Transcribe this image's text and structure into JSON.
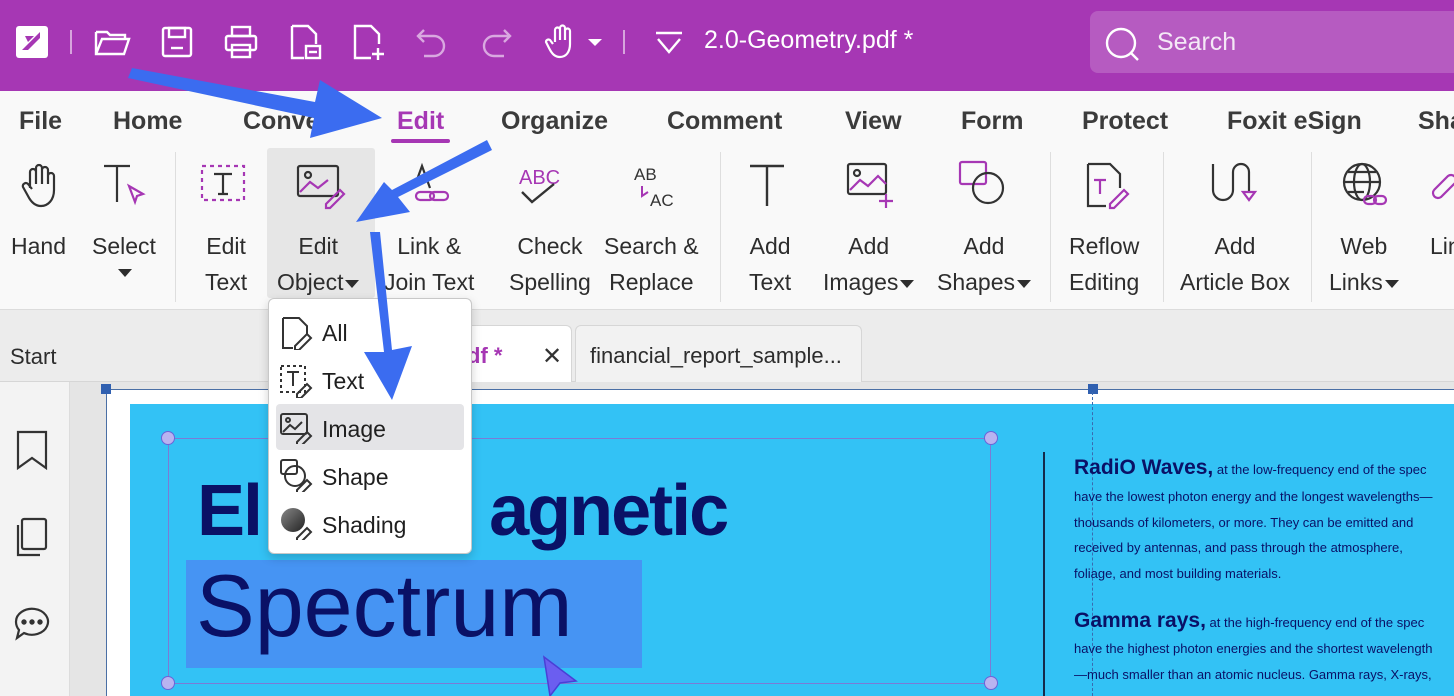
{
  "titlebar": {
    "doc_title": "2.0-Geometry.pdf *",
    "search_placeholder": "Search",
    "icons": [
      "foxit-logo-icon",
      "open-folder-icon",
      "save-icon",
      "print-icon",
      "new-from-file-icon",
      "new-blank-icon",
      "undo-icon",
      "redo-icon",
      "hand-tool-icon",
      "chevron-down-icon",
      "quick-access-dropdown-icon",
      "search-icon"
    ]
  },
  "menu": {
    "tabs": [
      "File",
      "Home",
      "Conve",
      "Edit",
      "Organize",
      "Comment",
      "View",
      "Form",
      "Protect",
      "Foxit eSign",
      "Sha"
    ],
    "active": "Edit"
  },
  "ribbon": {
    "hand": {
      "l1": "Hand",
      "l2": ""
    },
    "select": {
      "l1": "Select",
      "l2": ""
    },
    "edit_text": {
      "l1": "Edit",
      "l2": "Text"
    },
    "edit_object": {
      "l1": "Edit",
      "l2": "Object"
    },
    "link_join": {
      "l1": "Link &",
      "l2": "Join Text"
    },
    "check_spelling": {
      "l1": "Check",
      "l2": "Spelling"
    },
    "search_replace": {
      "l1": "Search &",
      "l2": "Replace"
    },
    "add_text": {
      "l1": "Add",
      "l2": "Text"
    },
    "add_images": {
      "l1": "Add",
      "l2": "Images"
    },
    "add_shapes": {
      "l1": "Add",
      "l2": "Shapes"
    },
    "reflow_editing": {
      "l1": "Reflow",
      "l2": "Editing"
    },
    "add_article_box": {
      "l1": "Add",
      "l2": "Article Box"
    },
    "web_links": {
      "l1": "Web",
      "l2": "Links"
    },
    "lin": {
      "l1": "Lin",
      "l2": ""
    },
    "check_icon_text": "ABC",
    "search_icon_text_top": "AB",
    "search_icon_text_bottom": "AC"
  },
  "tabs": {
    "start": "Start",
    "doc1": "df *",
    "doc1_close": "✕",
    "doc2": "financial_report_sample..."
  },
  "dropdown": {
    "items": [
      "All",
      "Text",
      "Image",
      "Shape",
      "Shading"
    ],
    "highlighted": "Image"
  },
  "document": {
    "title_line1": "Electromagnetic",
    "title_line1_visible": "El",
    "title_line1_visible_b": "agnetic",
    "title_line2": "Spectrum",
    "radio_head": "RadiO Waves,",
    "radio_lines": [
      "at the low-frequency end of the spec",
      "have the lowest photon energy and the longest wavelengths—",
      "thousands of kilometers, or more. They can be emitted and",
      "received by antennas, and pass through the atmosphere,",
      "foliage, and most building materials."
    ],
    "gamma_head": "Gamma rays,",
    "gamma_lines": [
      "at the high-frequency end of the spec",
      "have the highest photon energies and the shortest wavelength",
      "—much smaller than an atomic nucleus. Gamma rays, X-rays,"
    ]
  },
  "colors": {
    "brand": "#a637b4",
    "panel": "#33c2f5",
    "title_text": "#0a1166",
    "arrow": "#3b6cf0"
  }
}
